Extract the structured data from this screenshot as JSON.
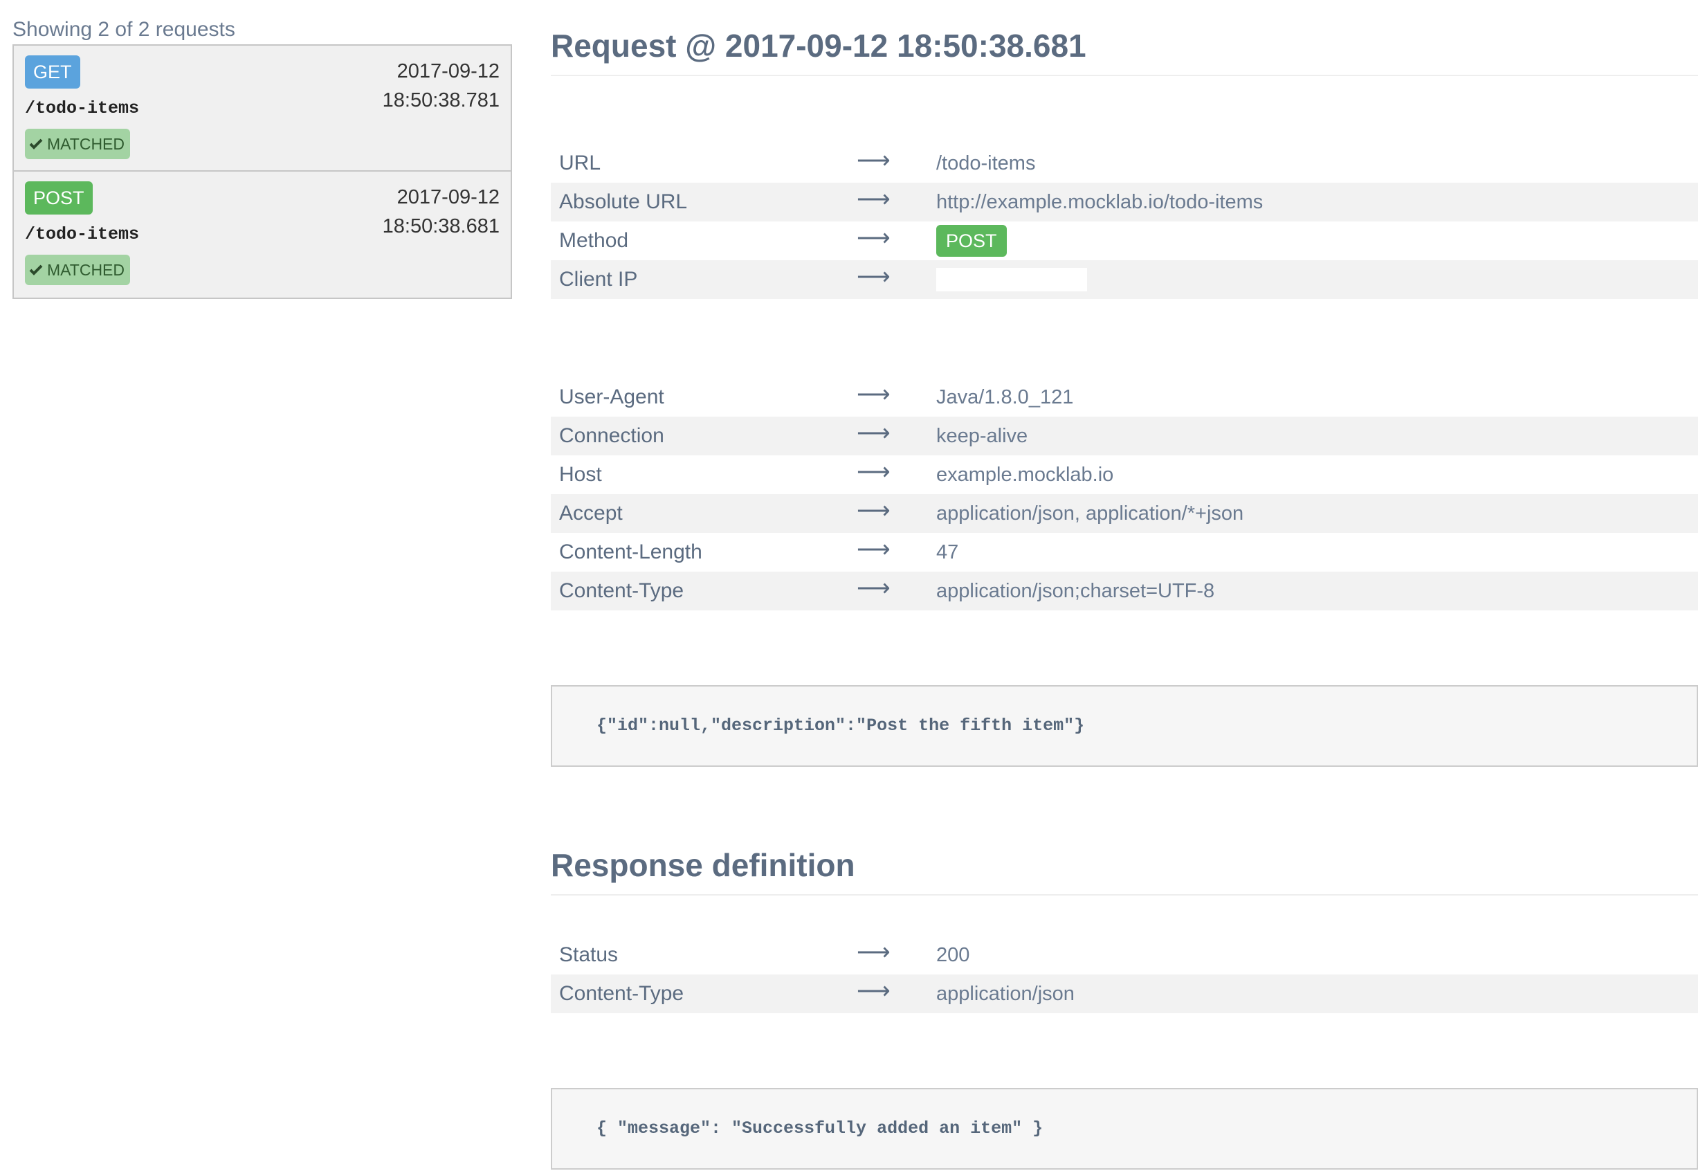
{
  "sidebar": {
    "showing": "Showing 2 of 2 requests",
    "requests": [
      {
        "method": "GET",
        "path": "/todo-items",
        "date": "2017-09-12",
        "time": "18:50:38.781",
        "status": "MATCHED",
        "method_color": "#5ba3dd"
      },
      {
        "method": "POST",
        "path": "/todo-items",
        "date": "2017-09-12",
        "time": "18:50:38.681",
        "status": "MATCHED",
        "method_color": "#5cb85c"
      }
    ]
  },
  "request": {
    "title": "Request @ 2017-09-12 18:50:38.681",
    "fields": [
      {
        "key": "URL",
        "value": "/todo-items"
      },
      {
        "key": "Absolute URL",
        "value": "http://example.mocklab.io/todo-items"
      },
      {
        "key": "Method",
        "value": "POST"
      },
      {
        "key": "Client IP",
        "value": ""
      }
    ],
    "headers": [
      {
        "key": "User-Agent",
        "value": "Java/1.8.0_121"
      },
      {
        "key": "Connection",
        "value": "keep-alive"
      },
      {
        "key": "Host",
        "value": "example.mocklab.io"
      },
      {
        "key": "Accept",
        "value": "application/json, application/*+json"
      },
      {
        "key": "Content-Length",
        "value": "47"
      },
      {
        "key": "Content-Type",
        "value": "application/json;charset=UTF-8"
      }
    ],
    "body": "{\"id\":null,\"description\":\"Post the fifth item\"}"
  },
  "response": {
    "title": "Response definition",
    "fields": [
      {
        "key": "Status",
        "value": "200"
      },
      {
        "key": "Content-Type",
        "value": "application/json"
      }
    ],
    "body": "{ \"message\": \"Successfully added an item\" }"
  },
  "icons": {
    "arrow": "right-arrow-icon",
    "check": "check-icon"
  },
  "colors": {
    "get_badge": "#5ba3dd",
    "post_badge": "#5cb85c",
    "matched_badge": "#a3d3a3",
    "text": "#5b6b80"
  }
}
